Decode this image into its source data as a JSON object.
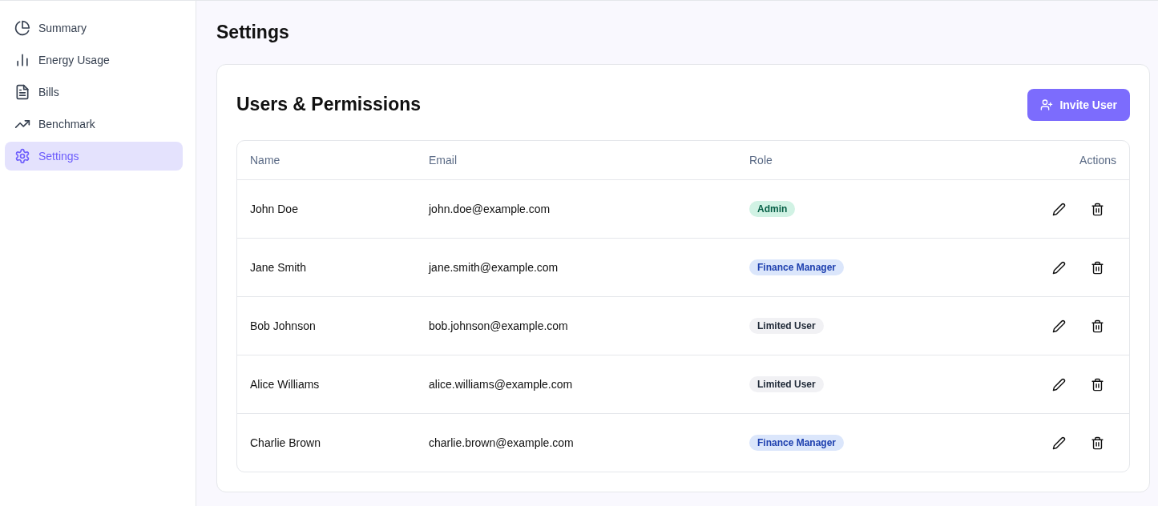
{
  "sidebar": {
    "items": [
      {
        "label": "Summary",
        "selected": false
      },
      {
        "label": "Energy Usage",
        "selected": false
      },
      {
        "label": "Bills",
        "selected": false
      },
      {
        "label": "Benchmark",
        "selected": false
      },
      {
        "label": "Settings",
        "selected": true
      }
    ]
  },
  "page_title": "Settings",
  "card": {
    "title": "Users & Permissions",
    "invite_button": "Invite User",
    "table": {
      "columns": [
        "Name",
        "Email",
        "Role",
        "Actions"
      ],
      "rows": [
        {
          "name": "John Doe",
          "email": "john.doe@example.com",
          "role": "Admin",
          "kind": "admin"
        },
        {
          "name": "Jane Smith",
          "email": "jane.smith@example.com",
          "role": "Finance Manager",
          "kind": "finance"
        },
        {
          "name": "Bob Johnson",
          "email": "bob.johnson@example.com",
          "role": "Limited User",
          "kind": "limited"
        },
        {
          "name": "Alice Williams",
          "email": "alice.williams@example.com",
          "role": "Limited User",
          "kind": "limited"
        },
        {
          "name": "Charlie Brown",
          "email": "charlie.brown@example.com",
          "role": "Finance Manager",
          "kind": "finance"
        }
      ]
    }
  }
}
